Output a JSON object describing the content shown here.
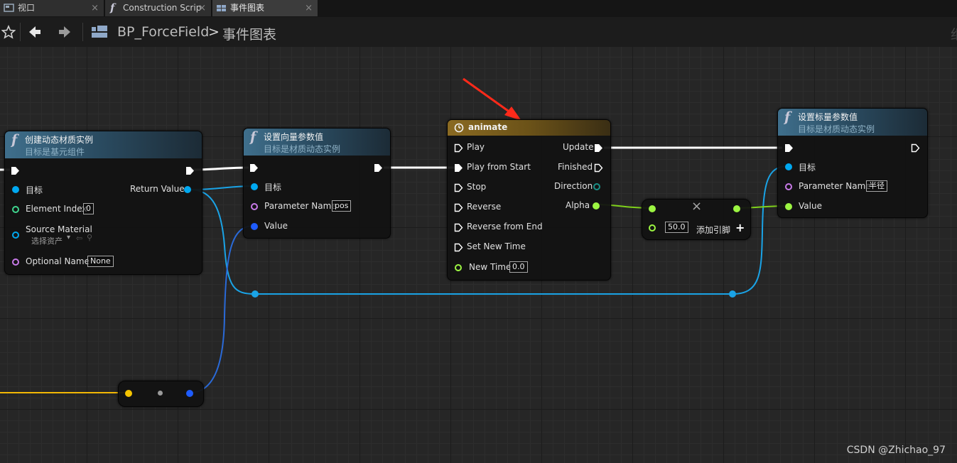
{
  "tabs": [
    {
      "label": "视口",
      "icon": "viewport-icon",
      "close": "×"
    },
    {
      "label": "Construction Scrip",
      "icon": "function-icon",
      "close": "×"
    },
    {
      "label": "事件图表",
      "icon": "event-graph-icon",
      "close": "×"
    }
  ],
  "toolbar": {
    "breadcrumb_root": "BP_ForceField",
    "breadcrumb_sep": ">",
    "breadcrumb_current": "事件图表",
    "right_partial": "细"
  },
  "nodes": {
    "create_dmi": {
      "title": "创建动态材质实例",
      "subtitle": "目标是基元组件",
      "target_label": "目标",
      "element_index_label": "Element Index",
      "element_index_value": "0",
      "source_material_label": "Source Material",
      "source_material_value": "选择资产",
      "optional_name_label": "Optional Name",
      "optional_name_value": "None",
      "return_label": "Return Value",
      "func_glyph": "f"
    },
    "set_vector": {
      "title": "设置向量参数值",
      "subtitle": "目标是材质动态实例",
      "target_label": "目标",
      "param_label": "Parameter Name",
      "param_value": "pos",
      "value_label": "Value",
      "func_glyph": "f"
    },
    "timeline": {
      "title": "animate",
      "inputs": [
        "Play",
        "Play from Start",
        "Stop",
        "Reverse",
        "Reverse from End",
        "Set New Time"
      ],
      "new_time_label": "New Time",
      "new_time_value": "0.0",
      "outputs": [
        "Update",
        "Finished",
        "Direction",
        "Alpha"
      ]
    },
    "multiply": {
      "b_value": "50.0",
      "add_pin_label": "添加引脚",
      "op_symbol": "×",
      "plus_symbol": "+"
    },
    "set_scalar": {
      "title": "设置标量参数值",
      "subtitle": "目标是材质动态实例",
      "target_label": "目标",
      "param_label": "Parameter Name",
      "param_value": "半径",
      "value_label": "Value",
      "func_glyph": "f"
    }
  },
  "colors": {
    "object_pin": "#00a8f0",
    "exec_pin": "#ffffff",
    "float_pin": "#9cf542",
    "int_pin": "#3fd68f",
    "name_pin": "#c87ae8",
    "vector_pin": "#f5c400",
    "struct_pin": "#1e5cff",
    "annotation_arrow": "#ff2a1a"
  },
  "watermark": "CSDN @Zhichao_97"
}
